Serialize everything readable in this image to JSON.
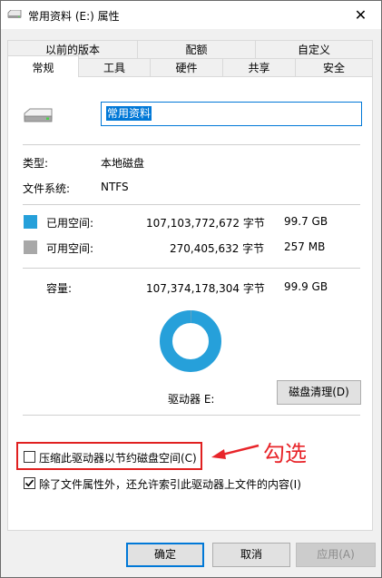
{
  "window": {
    "title": "常用资料 (E:) 属性",
    "close_glyph": "✕"
  },
  "tabs": {
    "row1": [
      "以前的版本",
      "配额",
      "自定义"
    ],
    "row2": [
      "常规",
      "工具",
      "硬件",
      "共享",
      "安全"
    ],
    "active": "常规"
  },
  "general": {
    "name_value": "常用资料",
    "type_label": "类型:",
    "type_value": "本地磁盘",
    "fs_label": "文件系统:",
    "fs_value": "NTFS",
    "used_label": "已用空间:",
    "used_bytes": "107,103,772,672 字节",
    "used_size": "99.7 GB",
    "free_label": "可用空间:",
    "free_bytes": "270,405,632 字节",
    "free_size": "257 MB",
    "capacity_label": "容量:",
    "capacity_bytes": "107,374,178,304 字节",
    "capacity_size": "99.9 GB",
    "drive_label": "驱动器 E:",
    "cleanup_button": "磁盘清理(D)",
    "compress_label": "压缩此驱动器以节约磁盘空间(C)",
    "compress_checked": false,
    "index_label": "除了文件属性外，还允许索引此驱动器上文件的内容(I)",
    "index_checked": true
  },
  "colors": {
    "used": "#26a0da",
    "free": "#a8a8a8",
    "annotation": "#e8252a"
  },
  "usage": {
    "used_fraction": 0.9975
  },
  "annotation": {
    "text": "勾选"
  },
  "footer": {
    "ok": "确定",
    "cancel": "取消",
    "apply": "应用(A)"
  },
  "icons": {
    "title": "drive-icon",
    "drive": "hard-drive-icon"
  }
}
